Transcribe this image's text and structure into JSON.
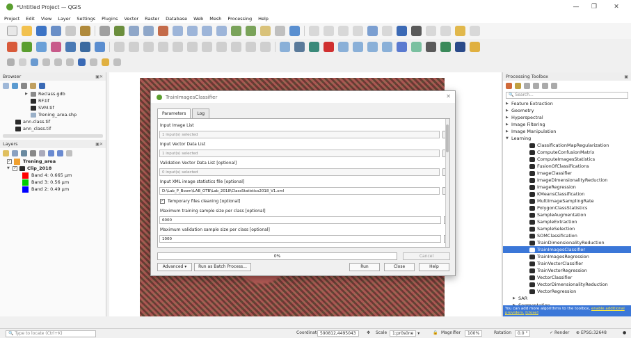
{
  "window": {
    "title": "*Untitled Project — QGIS",
    "min": "—",
    "max": "❐",
    "close": "✕"
  },
  "menu": [
    "Project",
    "Edit",
    "View",
    "Layer",
    "Settings",
    "Plugins",
    "Vector",
    "Raster",
    "Database",
    "Web",
    "Mesh",
    "Processing",
    "Help"
  ],
  "browser": {
    "title": "Browser",
    "items": [
      "Reclass.gdb",
      "RF.tif",
      "SVM.tif",
      "Trening_area.shp",
      "ann.class.tif",
      "ann_class.tif"
    ]
  },
  "layers": {
    "title": "Layers",
    "items": [
      {
        "label": "Trening_area",
        "color": "#f0a030"
      },
      {
        "label": "Clip_2018",
        "color": ""
      },
      {
        "label": "Band 4: 0.665 µm",
        "color": "#ff0000"
      },
      {
        "label": "Band 3: 0.56 µm",
        "color": "#00cc00"
      },
      {
        "label": "Band 2: 0.49 µm",
        "color": "#0000ff"
      }
    ]
  },
  "dialog": {
    "title": "TrainImagesClassifier",
    "tabs": [
      "Parameters",
      "Log"
    ],
    "fields": {
      "input_image_label": "Input Image List",
      "input_image_value": "1 input(s) selected",
      "vector_label": "Input Vector Data List",
      "vector_value": "1 input(s) selected",
      "validation_label": "Validation Vector Data List [optional]",
      "validation_value": "0 input(s) selected",
      "xml_label": "Input XML image statistics file [optional]",
      "xml_value": "D:\\Lab_P_Boom\\LAB_OTB\\Lab_2018\\ClassStatistics2018_V1.xml",
      "cleaning_label": "Temporary files cleaning [optional]",
      "max_training_label": "Maximum training sample size per class [optional]",
      "max_training_value": "6000",
      "max_validation_label": "Maximum validation sample size per class [optional]",
      "max_validation_value": "1000"
    },
    "progress": "0%",
    "buttons": {
      "cancel_top": "Cancel",
      "advanced": "Advanced",
      "batch": "Run as Batch Process...",
      "run": "Run",
      "close": "Close",
      "help": "Help"
    }
  },
  "processing": {
    "title": "Processing Toolbox",
    "search_placeholder": "Search...",
    "groups": [
      "Feature Extraction",
      "Geometry",
      "Hyperspectral",
      "Image Filtering",
      "Image Manipulation",
      "Learning"
    ],
    "learning_items": [
      "ClassificationMapRegularization",
      "ComputeConfusionMatrix",
      "ComputeImagesStatistics",
      "FusionOfClassifications",
      "ImageClassifier",
      "ImageDimensionalityReduction",
      "ImageRegression",
      "KMeansClassification",
      "MultiImageSamplingRate",
      "PolygonClassStatistics",
      "SampleAugmentation",
      "SampleExtraction",
      "SampleSelection",
      "SOMClassification",
      "TrainDimensionalityReduction",
      "TrainImagesClassifier",
      "TrainImagesRegression",
      "TrainVectorClassifier",
      "TrainVectorRegression",
      "VectorClassifier",
      "VectorDimensionalityReduction",
      "VectorRegression"
    ],
    "selected": "TrainImagesClassifier",
    "more_groups": [
      "SAR",
      "Segmentation"
    ],
    "note_text": "You can add more algorithms to the toolbox, ",
    "note_link": "enable additional providers.",
    "note_close": "[close]"
  },
  "status": {
    "locate_placeholder": "Type to locate (Ctrl+K)",
    "coordinate_label": "Coordinate",
    "coordinate_value": "590812,4495043",
    "scale_label": "Scale",
    "scale_value": "1:pr0s0ne",
    "magnifier_label": "Magnifier",
    "magnifier_value": "100%",
    "rotation_label": "Rotation",
    "rotation_value": "0.0 °",
    "render_label": "Render",
    "crs_label": "EPSG:32648"
  }
}
